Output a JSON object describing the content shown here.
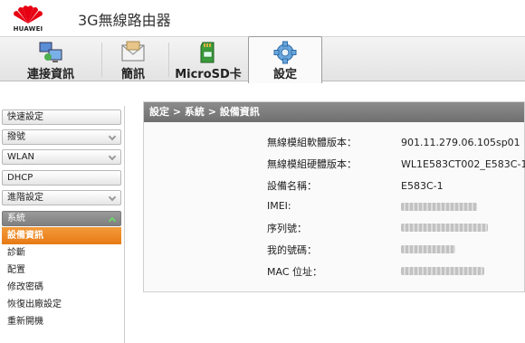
{
  "header": {
    "brand": "HUAWEI",
    "title": "3G無線路由器"
  },
  "tabs": [
    {
      "label": "連接資訊",
      "icon": "network-computers-icon",
      "active": false
    },
    {
      "label": "簡訊",
      "icon": "envelope-icon",
      "active": false
    },
    {
      "label": "MicroSD卡",
      "icon": "sd-card-icon",
      "active": false
    },
    {
      "label": "設定",
      "icon": "gear-icon",
      "active": true
    }
  ],
  "sidebar": {
    "items": [
      {
        "label": "快速設定",
        "has_chevron": false
      },
      {
        "label": "撥號",
        "has_chevron": true
      },
      {
        "label": "WLAN",
        "has_chevron": true
      },
      {
        "label": "DHCP",
        "has_chevron": false
      },
      {
        "label": "進階設定",
        "has_chevron": true
      },
      {
        "label": "系統",
        "has_chevron": true,
        "open": true
      }
    ],
    "submenu": [
      {
        "label": "設備資訊",
        "active": true
      },
      {
        "label": "診斷",
        "active": false
      },
      {
        "label": "配置",
        "active": false
      },
      {
        "label": "修改密碼",
        "active": false
      },
      {
        "label": "恢復出廠設定",
        "active": false
      },
      {
        "label": "重新開機",
        "active": false
      }
    ]
  },
  "content": {
    "breadcrumb": "設定 > 系統 > 設備資訊",
    "rows": [
      {
        "label": "無線模組軟體版本：",
        "value": "901.11.279.06.105sp01"
      },
      {
        "label": "無線模組硬體版本：",
        "value": "WL1E583CT002_E583C-1"
      },
      {
        "label": "設備名稱：",
        "value": "E583C-1"
      },
      {
        "label": "IMEI:",
        "value": ""
      },
      {
        "label": "序列號：",
        "value": ""
      },
      {
        "label": "我的號碼：",
        "value": ""
      },
      {
        "label": "MAC 位址：",
        "value": ""
      }
    ]
  },
  "colors": {
    "brand_red": "#e60012",
    "active_orange": "#ee8a22",
    "header_gray": "#7d7d7d"
  }
}
